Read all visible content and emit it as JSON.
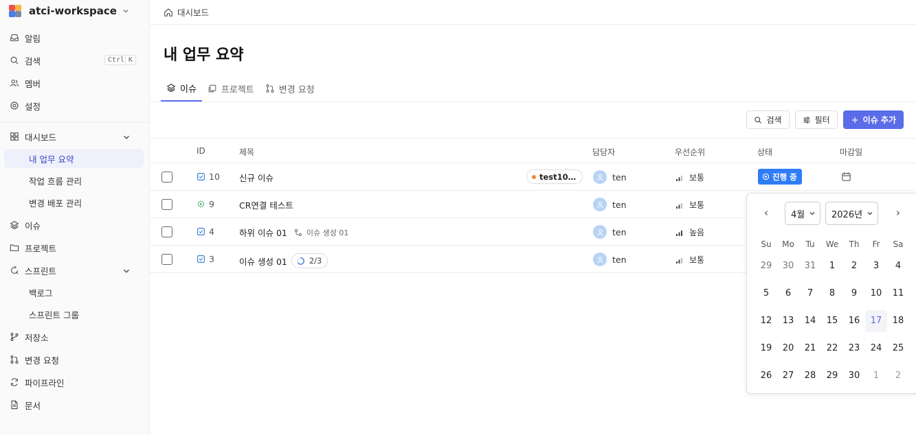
{
  "workspace": {
    "name": "atci-workspace"
  },
  "sidebar": {
    "items": [
      {
        "label": "알림"
      },
      {
        "label": "검색",
        "kbd": [
          "Ctrl",
          "K"
        ]
      },
      {
        "label": "멤버"
      },
      {
        "label": "설정"
      },
      {
        "label": "대시보드"
      },
      {
        "label": "내 업무 요약"
      },
      {
        "label": "작업 흐름 관리"
      },
      {
        "label": "변경 배포 관리"
      },
      {
        "label": "이슈"
      },
      {
        "label": "프로젝트"
      },
      {
        "label": "스프린트"
      },
      {
        "label": "백로그"
      },
      {
        "label": "스프린트 그룹"
      },
      {
        "label": "저장소"
      },
      {
        "label": "변경 요청"
      },
      {
        "label": "파이프라인"
      },
      {
        "label": "문서"
      }
    ]
  },
  "breadcrumb": {
    "label": "대시보드"
  },
  "page": {
    "title": "내 업무 요약"
  },
  "tabs": [
    {
      "label": "이슈"
    },
    {
      "label": "프로젝트"
    },
    {
      "label": "변경 요청"
    }
  ],
  "toolbar": {
    "search_label": "검색",
    "filter_label": "필터",
    "add_label": "이슈 추가"
  },
  "table": {
    "headers": {
      "id": "ID",
      "title": "제목",
      "assignee": "담당자",
      "priority": "우선순위",
      "status": "상태",
      "due": "마감일"
    },
    "rows": [
      {
        "id": "10",
        "title": "신규 이슈",
        "tag": "test10…",
        "assignee": "ten",
        "priority": "보통",
        "status": "진행 중"
      },
      {
        "id": "9",
        "title": "CR연결 테스트",
        "assignee": "ten",
        "priority": "보통"
      },
      {
        "id": "4",
        "title": "하위 이슈 01",
        "parent": "이슈 생성 01",
        "assignee": "ten",
        "priority": "높음"
      },
      {
        "id": "3",
        "title": "이슈 생성 01",
        "progress": "2/3",
        "assignee": "ten",
        "priority": "보통"
      }
    ]
  },
  "calendar": {
    "month": "4월",
    "year": "2026년",
    "prev": "‹",
    "next": "›",
    "weekdays": [
      "Su",
      "Mo",
      "Tu",
      "We",
      "Th",
      "Fr",
      "Sa"
    ],
    "weeks": [
      [
        "29",
        "30",
        "31",
        "1",
        "2",
        "3",
        "4"
      ],
      [
        "5",
        "6",
        "7",
        "8",
        "9",
        "10",
        "11"
      ],
      [
        "12",
        "13",
        "14",
        "15",
        "16",
        "17",
        "18"
      ],
      [
        "19",
        "20",
        "21",
        "22",
        "23",
        "24",
        "25"
      ],
      [
        "26",
        "27",
        "28",
        "29",
        "30",
        "1",
        "2"
      ]
    ],
    "today": "17"
  },
  "colors": {
    "accent": "#5b6ce8",
    "status_in_progress": "#2f7cf6",
    "tag_dot": "#f08a3c",
    "avatar": "#b8d4f4"
  }
}
